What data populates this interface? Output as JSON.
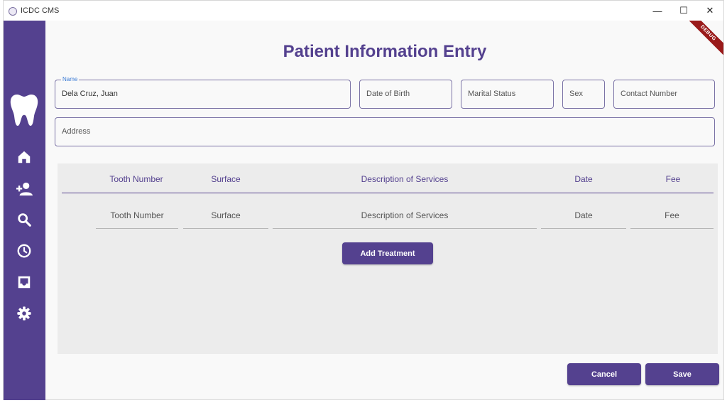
{
  "app": {
    "title": "ICDC CMS"
  },
  "window_controls": {
    "minimize": "—",
    "maximize": "☐",
    "close": "✕"
  },
  "debug_banner": "DEBUG",
  "sidebar": {
    "items": [
      {
        "name": "home",
        "icon": "home-icon"
      },
      {
        "name": "add-patient",
        "icon": "person-add-icon"
      },
      {
        "name": "search",
        "icon": "search-icon"
      },
      {
        "name": "history",
        "icon": "clock-icon"
      },
      {
        "name": "inbox",
        "icon": "inbox-icon"
      },
      {
        "name": "settings",
        "icon": "gear-icon"
      }
    ],
    "logo_icon": "tooth-icon"
  },
  "page": {
    "title": "Patient Information Entry"
  },
  "form": {
    "name": {
      "label": "Name",
      "value": "Dela Cruz, Juan"
    },
    "date_of_birth": {
      "placeholder": "Date of Birth"
    },
    "marital_status": {
      "placeholder": "Marital Status"
    },
    "sex": {
      "placeholder": "Sex"
    },
    "contact_number": {
      "placeholder": "Contact Number"
    },
    "address": {
      "placeholder": "Address"
    }
  },
  "treatments": {
    "columns": [
      "Tooth Number",
      "Surface",
      "Description of Services",
      "Date",
      "Fee"
    ],
    "row_placeholders": [
      "Tooth Number",
      "Surface",
      "Description of Services",
      "Date",
      "Fee"
    ],
    "add_button": "Add Treatment"
  },
  "actions": {
    "cancel": "Cancel",
    "save": "Save"
  },
  "colors": {
    "primary": "#54418f",
    "accent_label": "#3a7bd5",
    "panel_bg": "#ececec",
    "debug_ribbon": "#9a1b1b"
  }
}
